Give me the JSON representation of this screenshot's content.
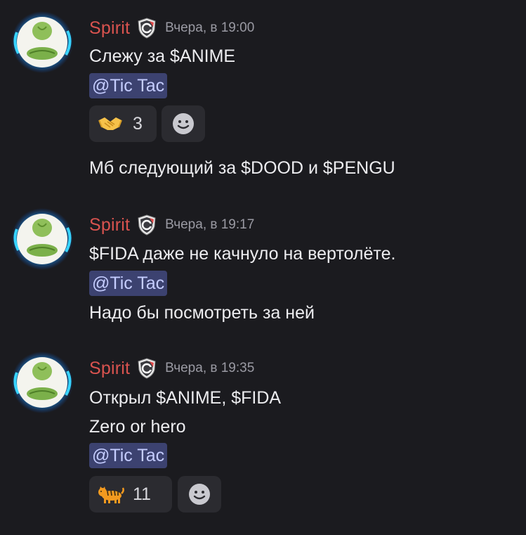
{
  "messages": [
    {
      "author": "Spirit",
      "timestamp": "Вчера, в 19:00",
      "lines": [
        "Слежу за $ANIME"
      ],
      "mention": "@Tic Tac",
      "reaction": {
        "emoji": "handshake-emoji",
        "count": "3"
      }
    },
    {
      "lines": [
        "Мб следующий за $DOOD  и $PENGU"
      ]
    },
    {
      "author": "Spirit",
      "timestamp": "Вчера, в 19:17",
      "lines": [
        "$FIDA даже не качнуло на вертолёте."
      ],
      "mention": "@Tic Tac",
      "after_mention": "Надо бы посмотреть за ней"
    },
    {
      "author": "Spirit",
      "timestamp": "Вчера, в 19:35",
      "lines": [
        "Открыл $ANIME, $FIDA",
        "Zero or hero"
      ],
      "mention": "@Tic Tac",
      "reaction": {
        "emoji": "tiger-emoji",
        "count": "11"
      }
    }
  ],
  "colors": {
    "background": "#1b1b1f",
    "author": "#d9534f",
    "timestamp": "#9a9aa3",
    "mention_bg": "#3c4270",
    "mention_text": "#c5cdff",
    "reaction_bg": "#2b2b30"
  },
  "icons": {
    "avatar": "cabbage-avatar-icon",
    "badge": "shield-badge-icon",
    "add_reaction": "smiley-add-reaction-icon"
  }
}
